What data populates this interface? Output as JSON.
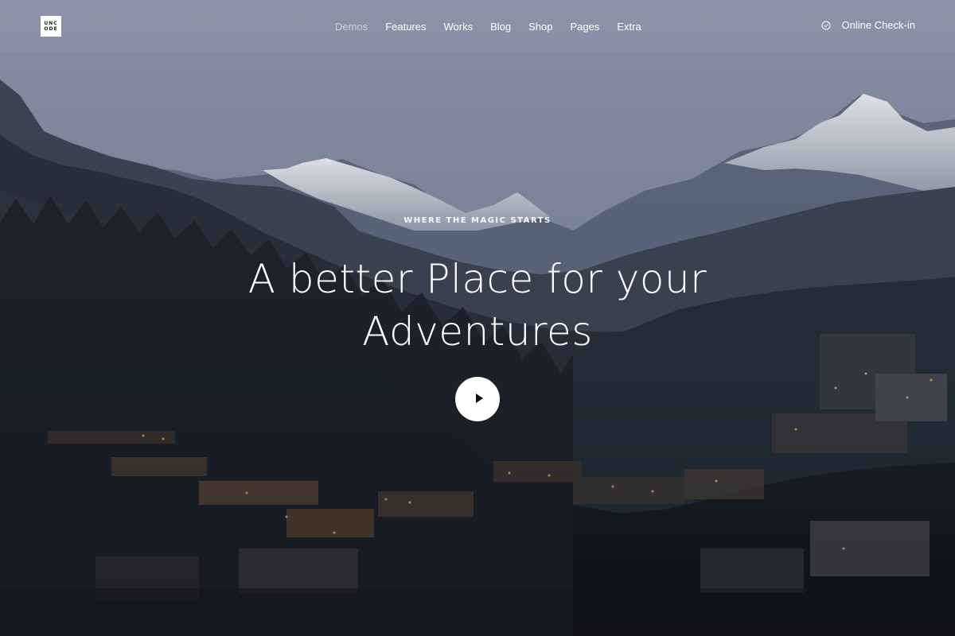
{
  "brand": {
    "logo_lines": [
      "UNC",
      "ODE"
    ]
  },
  "nav": {
    "items": [
      {
        "label": "Demos",
        "state": "active"
      },
      {
        "label": "Features"
      },
      {
        "label": "Works"
      },
      {
        "label": "Blog"
      },
      {
        "label": "Shop"
      },
      {
        "label": "Pages"
      },
      {
        "label": "Extra"
      }
    ]
  },
  "cta": {
    "label": "Online Check-in",
    "icon": "check-circle-icon"
  },
  "hero": {
    "eyebrow": "WHERE THE MAGIC STARTS",
    "headline_line1": "A better Place for your",
    "headline_line2": "Adventures",
    "play_icon": "play-icon"
  }
}
